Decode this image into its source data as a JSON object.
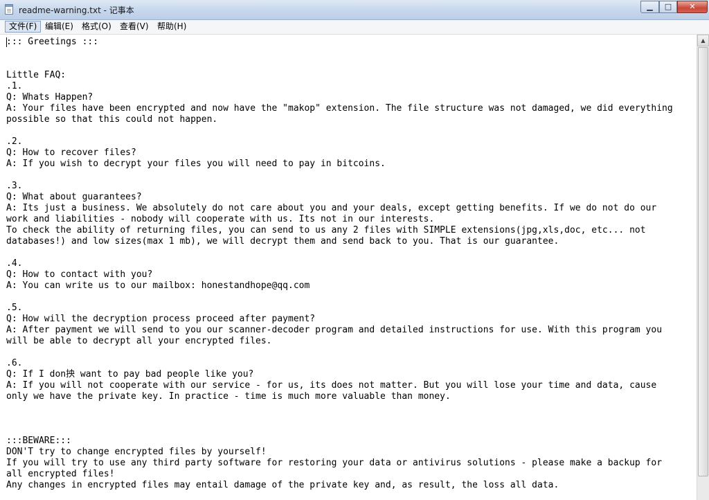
{
  "window": {
    "title": "readme-warning.txt - 记事本"
  },
  "controls": {
    "minimize": "▁",
    "maximize": "□",
    "close": "✕"
  },
  "menu": [
    {
      "label": "文件(F)"
    },
    {
      "label": "编辑(E)"
    },
    {
      "label": "格式(O)"
    },
    {
      "label": "查看(V)"
    },
    {
      "label": "帮助(H)"
    }
  ],
  "document": {
    "content": "::: Greetings :::\n\n\nLittle FAQ:\n.1.\nQ: Whats Happen?\nA: Your files have been encrypted and now have the \"makop\" extension. The file structure was not damaged, we did everything\npossible so that this could not happen.\n\n.2.\nQ: How to recover files?\nA: If you wish to decrypt your files you will need to pay in bitcoins.\n\n.3.\nQ: What about guarantees?\nA: Its just a business. We absolutely do not care about you and your deals, except getting benefits. If we do not do our\nwork and liabilities - nobody will cooperate with us. Its not in our interests.\nTo check the ability of returning files, you can send to us any 2 files with SIMPLE extensions(jpg,xls,doc, etc... not\ndatabases!) and low sizes(max 1 mb), we will decrypt them and send back to you. That is our guarantee.\n\n.4.\nQ: How to contact with you?\nA: You can write us to our mailbox: honestandhope@qq.com\n\n.5.\nQ: How will the decryption process proceed after payment?\nA: After payment we will send to you our scanner-decoder program and detailed instructions for use. With this program you\nwill be able to decrypt all your encrypted files.\n\n.6.\nQ: If I don抰 want to pay bad people like you?\nA: If you will not cooperate with our service - for us, its does not matter. But you will lose your time and data, cause\nonly we have the private key. In practice - time is much more valuable than money.\n\n\n\n:::BEWARE:::\nDON'T try to change encrypted files by yourself!\nIf you will try to use any third party software for restoring your data or antivirus solutions - please make a backup for\nall encrypted files!\nAny changes in encrypted files may entail damage of the private key and, as result, the loss all data."
  }
}
